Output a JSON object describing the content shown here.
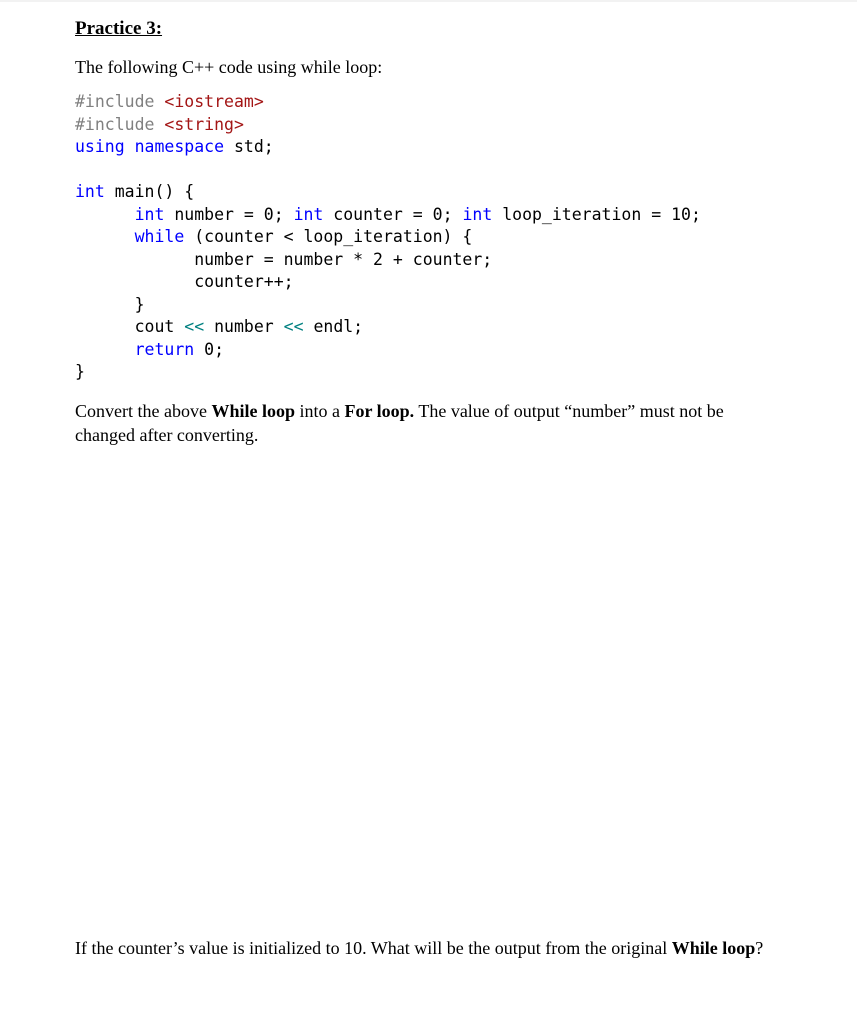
{
  "title": "Practice 3:",
  "intro": "The following C++ code using while loop:",
  "code": {
    "include1_directive": "#include",
    "include1_header": "<iostream>",
    "include2_directive": "#include",
    "include2_header": "<string>",
    "using_kw": "using namespace",
    "using_rest": " std;",
    "main_kw": "int",
    "main_rest": " main() {",
    "decl_int1": "int",
    "decl_number": " number = 0; ",
    "decl_int2": "int",
    "decl_counter": " counter = 0; ",
    "decl_int3": "int",
    "decl_loop": " loop_iteration = 10;",
    "while_kw": "while",
    "while_rest": " (counter < loop_iteration) {",
    "body1": "number = number * 2 + counter;",
    "body2": "counter++;",
    "close_while": "}",
    "cout_1": "cout ",
    "cout_op1": "<<",
    "cout_2": " number ",
    "cout_op2": "<<",
    "cout_3": " endl;",
    "return_kw": "return",
    "return_rest": " 0;",
    "close_main": "}"
  },
  "question1": {
    "part1": "Convert the above ",
    "bold1": "While loop",
    "part2": " into a ",
    "bold2": "For loop.",
    "part3": " The value of output “number” must not be changed after converting."
  },
  "question2": {
    "part1": "If the counter’s value is initialized to 10. What will be the output from the original ",
    "bold1": "While loop",
    "part2": "?"
  }
}
